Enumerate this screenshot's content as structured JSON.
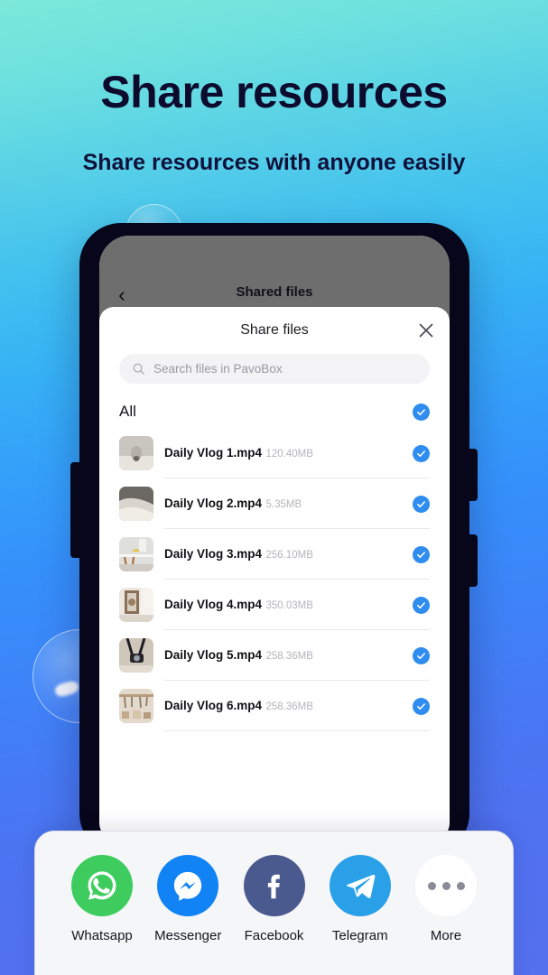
{
  "hero": {
    "headline": "Share resources",
    "subhead": "Share resources with anyone easily"
  },
  "colors": {
    "bg_top": "#7ce9da",
    "bg_bottom": "#5570ee",
    "accent_check": "#2e8def",
    "whatsapp": "#3ecc5f",
    "messenger": "#1283f5",
    "facebook": "#4a5a8e",
    "telegram": "#29a0e8",
    "sheet_bg": "#f5f6f8",
    "scrim": "#6e6e6e"
  },
  "app_screen": {
    "back_icon": "chevron-left-icon",
    "title": "Shared files"
  },
  "modal": {
    "title": "Share files",
    "close_icon": "close-icon",
    "search": {
      "icon": "search-icon",
      "placeholder": "Search files in PavoBox",
      "value": ""
    },
    "select_all": {
      "label": "All",
      "checked": true,
      "check_icon": "check-circle-icon"
    },
    "files": [
      {
        "name": "Daily Vlog 1.mp4",
        "size": "120.40MB",
        "checked": true,
        "thumb": "deer-antlers-photo"
      },
      {
        "name": "Daily Vlog 2.mp4",
        "size": "5.35MB",
        "checked": true,
        "thumb": "grey-bedding-photo"
      },
      {
        "name": "Daily Vlog 3.mp4",
        "size": "256.10MB",
        "checked": true,
        "thumb": "banana-on-table-photo"
      },
      {
        "name": "Daily Vlog 4.mp4",
        "size": "350.03MB",
        "checked": true,
        "thumb": "framed-mirror-photo"
      },
      {
        "name": "Daily Vlog 5.mp4",
        "size": "258.36MB",
        "checked": true,
        "thumb": "camera-strap-photo"
      },
      {
        "name": "Daily Vlog 6.mp4",
        "size": "258.36MB",
        "checked": true,
        "thumb": "wall-shelf-photo"
      }
    ]
  },
  "share_sheet": {
    "apps": [
      {
        "label": "Whatsapp",
        "icon": "whatsapp-icon"
      },
      {
        "label": "Messenger",
        "icon": "messenger-icon"
      },
      {
        "label": "Facebook",
        "icon": "facebook-icon"
      },
      {
        "label": "Telegram",
        "icon": "telegram-icon"
      },
      {
        "label": "More",
        "icon": "more-dots-icon"
      }
    ]
  }
}
